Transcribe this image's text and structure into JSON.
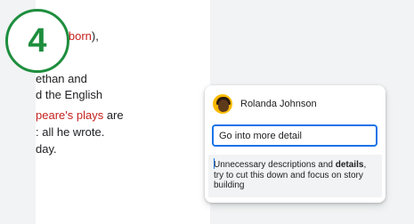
{
  "document": {
    "line1_red": "peare born",
    "line1_rest": "),",
    "line2": "ethan and",
    "line3": "d the English",
    "line4_red": "peare's plays",
    "line4_rest": " are",
    "line5": ": all he wrote.",
    "line6": "day."
  },
  "step_badge": "4",
  "comment": {
    "author": "Rolanda Johnson",
    "input_value": "Go into more detail",
    "suggestion": {
      "part1": "Unnecessary descriptions and ",
      "bold": "details",
      "part2": ", try to cut this down and focus on story building"
    }
  },
  "colors": {
    "accent": "#1a73e8",
    "badge_green": "#1e8e3e",
    "link_red": "#c5221f"
  }
}
